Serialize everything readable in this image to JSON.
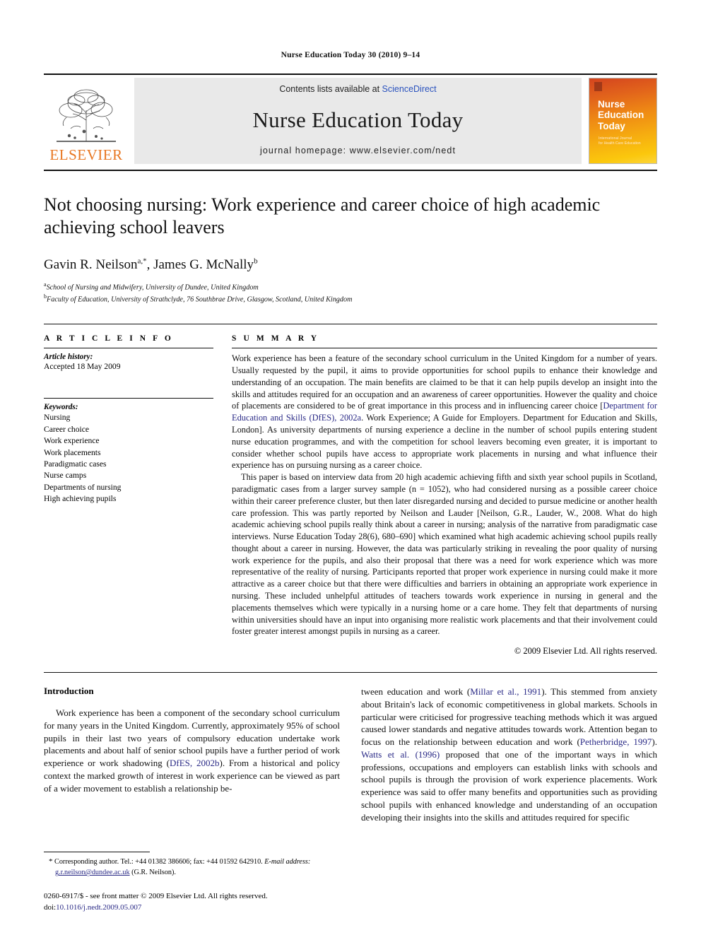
{
  "running_head": "Nurse Education Today 30 (2010) 9–14",
  "banner": {
    "publisher_wordmark": "ELSEVIER",
    "contents_prefix": "Contents lists available at ",
    "contents_link": "ScienceDirect",
    "journal_title": "Nurse Education Today",
    "homepage": "journal homepage: www.elsevier.com/nedt",
    "cover": {
      "line1": "Nurse",
      "line2": "Education",
      "line3": "Today",
      "subtitle1": "International Journal",
      "subtitle2": "for Health Care Education"
    }
  },
  "article": {
    "title": "Not choosing nursing: Work experience and career choice of high academic achieving school leavers",
    "authors": "Gavin R. Neilson a,*, James G. McNally b",
    "affiliation_a": "School of Nursing and Midwifery, University of Dundee, United Kingdom",
    "affiliation_b": "Faculty of Education, University of Strathclyde, 76 Southbrae Drive, Glasgow, Scotland, United Kingdom"
  },
  "article_info": {
    "heading": "A R T I C L E   I N F O",
    "history_label": "Article history:",
    "history_value": "Accepted 18 May 2009",
    "keywords_label": "Keywords:",
    "keywords": [
      "Nursing",
      "Career choice",
      "Work experience",
      "Work placements",
      "Paradigmatic cases",
      "Nurse camps",
      "Departments of nursing",
      "High achieving pupils"
    ]
  },
  "summary": {
    "heading": "S U M M A R Y",
    "paragraph1_part1": "Work experience has been a feature of the secondary school curriculum in the United Kingdom for a number of years. Usually requested by the pupil, it aims to provide opportunities for school pupils to enhance their knowledge and understanding of an occupation. The main benefits are claimed to be that it can help pupils develop an insight into the skills and attitudes required for an occupation and an awareness of career opportunities. However the quality and choice of placements are considered to be of great importance in this process and in influencing career choice [",
    "paragraph1_citation": "Department for Education and Skills (DfES), 2002a",
    "paragraph1_part2": ". Work Experience; A Guide for Employers. Department for Education and Skills, London]. As university departments of nursing experience a decline in the number of school pupils entering student nurse education programmes, and with the competition for school leavers becoming even greater, it is important to consider whether school pupils have access to appropriate work placements in nursing and what influence their experience has on pursuing nursing as a career choice.",
    "paragraph2": "This paper is based on interview data from 20 high academic achieving fifth and sixth year school pupils in Scotland, paradigmatic cases from a larger survey sample (n = 1052), who had considered nursing as a possible career choice within their career preference cluster, but then later disregarded nursing and decided to pursue medicine or another health care profession. This was partly reported by Neilson and Lauder [Neilson, G.R., Lauder, W., 2008. What do high academic achieving school pupils really think about a career in nursing; analysis of the narrative from paradigmatic case interviews. Nurse Education Today 28(6), 680–690] which examined what high academic achieving school pupils really thought about a career in nursing. However, the data was particularly striking in revealing the poor quality of nursing work experience for the pupils, and also their proposal that there was a need for work experience which was more representative of the reality of nursing. Participants reported that proper work experience in nursing could make it more attractive as a career choice but that there were difficulties and barriers in obtaining an appropriate work experience in nursing. These included unhelpful attitudes of teachers towards work experience in nursing in general and the placements themselves which were typically in a nursing home or a care home. They felt that departments of nursing within universities should have an input into organising more realistic work placements and that their involvement could foster greater interest amongst pupils in nursing as a career.",
    "copyright": "© 2009 Elsevier Ltd. All rights reserved."
  },
  "introduction": {
    "heading": "Introduction",
    "left_para_part1": "Work experience has been a component of the secondary school curriculum for many years in the United Kingdom. Currently, approximately 95% of school pupils in their last two years of compulsory education undertake work placements and about half of senior school pupils have a further period of work experience or work shadowing (",
    "left_citation": "DfES, 2002b",
    "left_para_part2": "). From a historical and policy context the marked growth of interest in work experience can be viewed as part of a wider movement to establish a relationship be-",
    "right_para_part1": "tween education and work (",
    "right_citation1": "Millar et al., 1991",
    "right_para_part2": "). This stemmed from anxiety about Britain's lack of economic competitiveness in global markets. Schools in particular were criticised for progressive teaching methods which it was argued caused lower standards and negative attitudes towards work. Attention began to focus on the relationship between education and work (",
    "right_citation2": "Petherbridge, 1997",
    "right_para_part3": "). ",
    "right_citation3": "Watts et al. (1996)",
    "right_para_part4": " proposed that one of the important ways in which professions, occupations and employers can establish links with schools and school pupils is through the provision of work experience placements. Work experience was said to offer many benefits and opportunities such as providing school pupils with enhanced knowledge and understanding of an occupation developing their insights into the skills and attitudes required for specific"
  },
  "footnotes": {
    "corresponding": "Corresponding author. Tel.: +44 01382 386606; fax: +44 01592 642910.",
    "email_label": "E-mail address:",
    "email": "g.r.neilson@dundee.ac.uk",
    "email_owner": "(G.R. Neilson).",
    "imprint_line1": "0260-6917/$ - see front matter © 2009 Elsevier Ltd. All rights reserved.",
    "doi_label": "doi:",
    "doi_value": "10.1016/j.nedt.2009.05.007"
  }
}
